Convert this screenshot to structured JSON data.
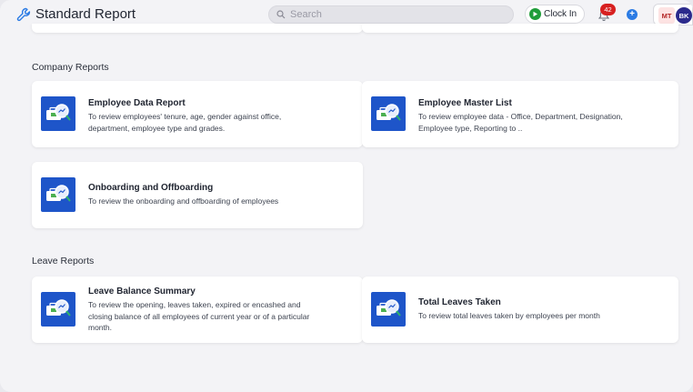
{
  "header": {
    "title": "Standard Report",
    "search_placeholder": "Search",
    "clock_in_label": "Clock In",
    "notification_count": "42",
    "avatars": [
      "MT",
      "BK"
    ]
  },
  "sections": [
    {
      "title": "Company Reports",
      "cards": [
        {
          "title": "Employee Data Report",
          "desc_lines": [
            "To review employees' tenure, age, gender against office,",
            "department, employee type and grades."
          ]
        },
        {
          "title": "Employee Master List",
          "desc_lines": [
            "To review employee data - Office, Department, Designation,",
            "Employee type, Reporting to .."
          ]
        },
        {
          "title": "Onboarding and Offboarding",
          "desc_lines": [
            "To review the onboarding and offboarding of employees"
          ]
        }
      ]
    },
    {
      "title": "Leave Reports",
      "cards": [
        {
          "title": "Leave Balance Summary",
          "desc_lines": [
            "To review the opening, leaves taken, expired or encashed and",
            "closing balance of all employees of current year or of a particular",
            "month."
          ]
        },
        {
          "title": "Total Leaves Taken",
          "desc_lines": [
            "To review total leaves taken by employees per month"
          ]
        }
      ]
    }
  ],
  "colors": {
    "accent": "#1e55c9",
    "clock": "#1f9d3a",
    "badge": "#d72020"
  },
  "icons": [
    "wrench-icon",
    "search-icon",
    "play-icon",
    "bell-icon",
    "plus-icon",
    "report-icon"
  ]
}
